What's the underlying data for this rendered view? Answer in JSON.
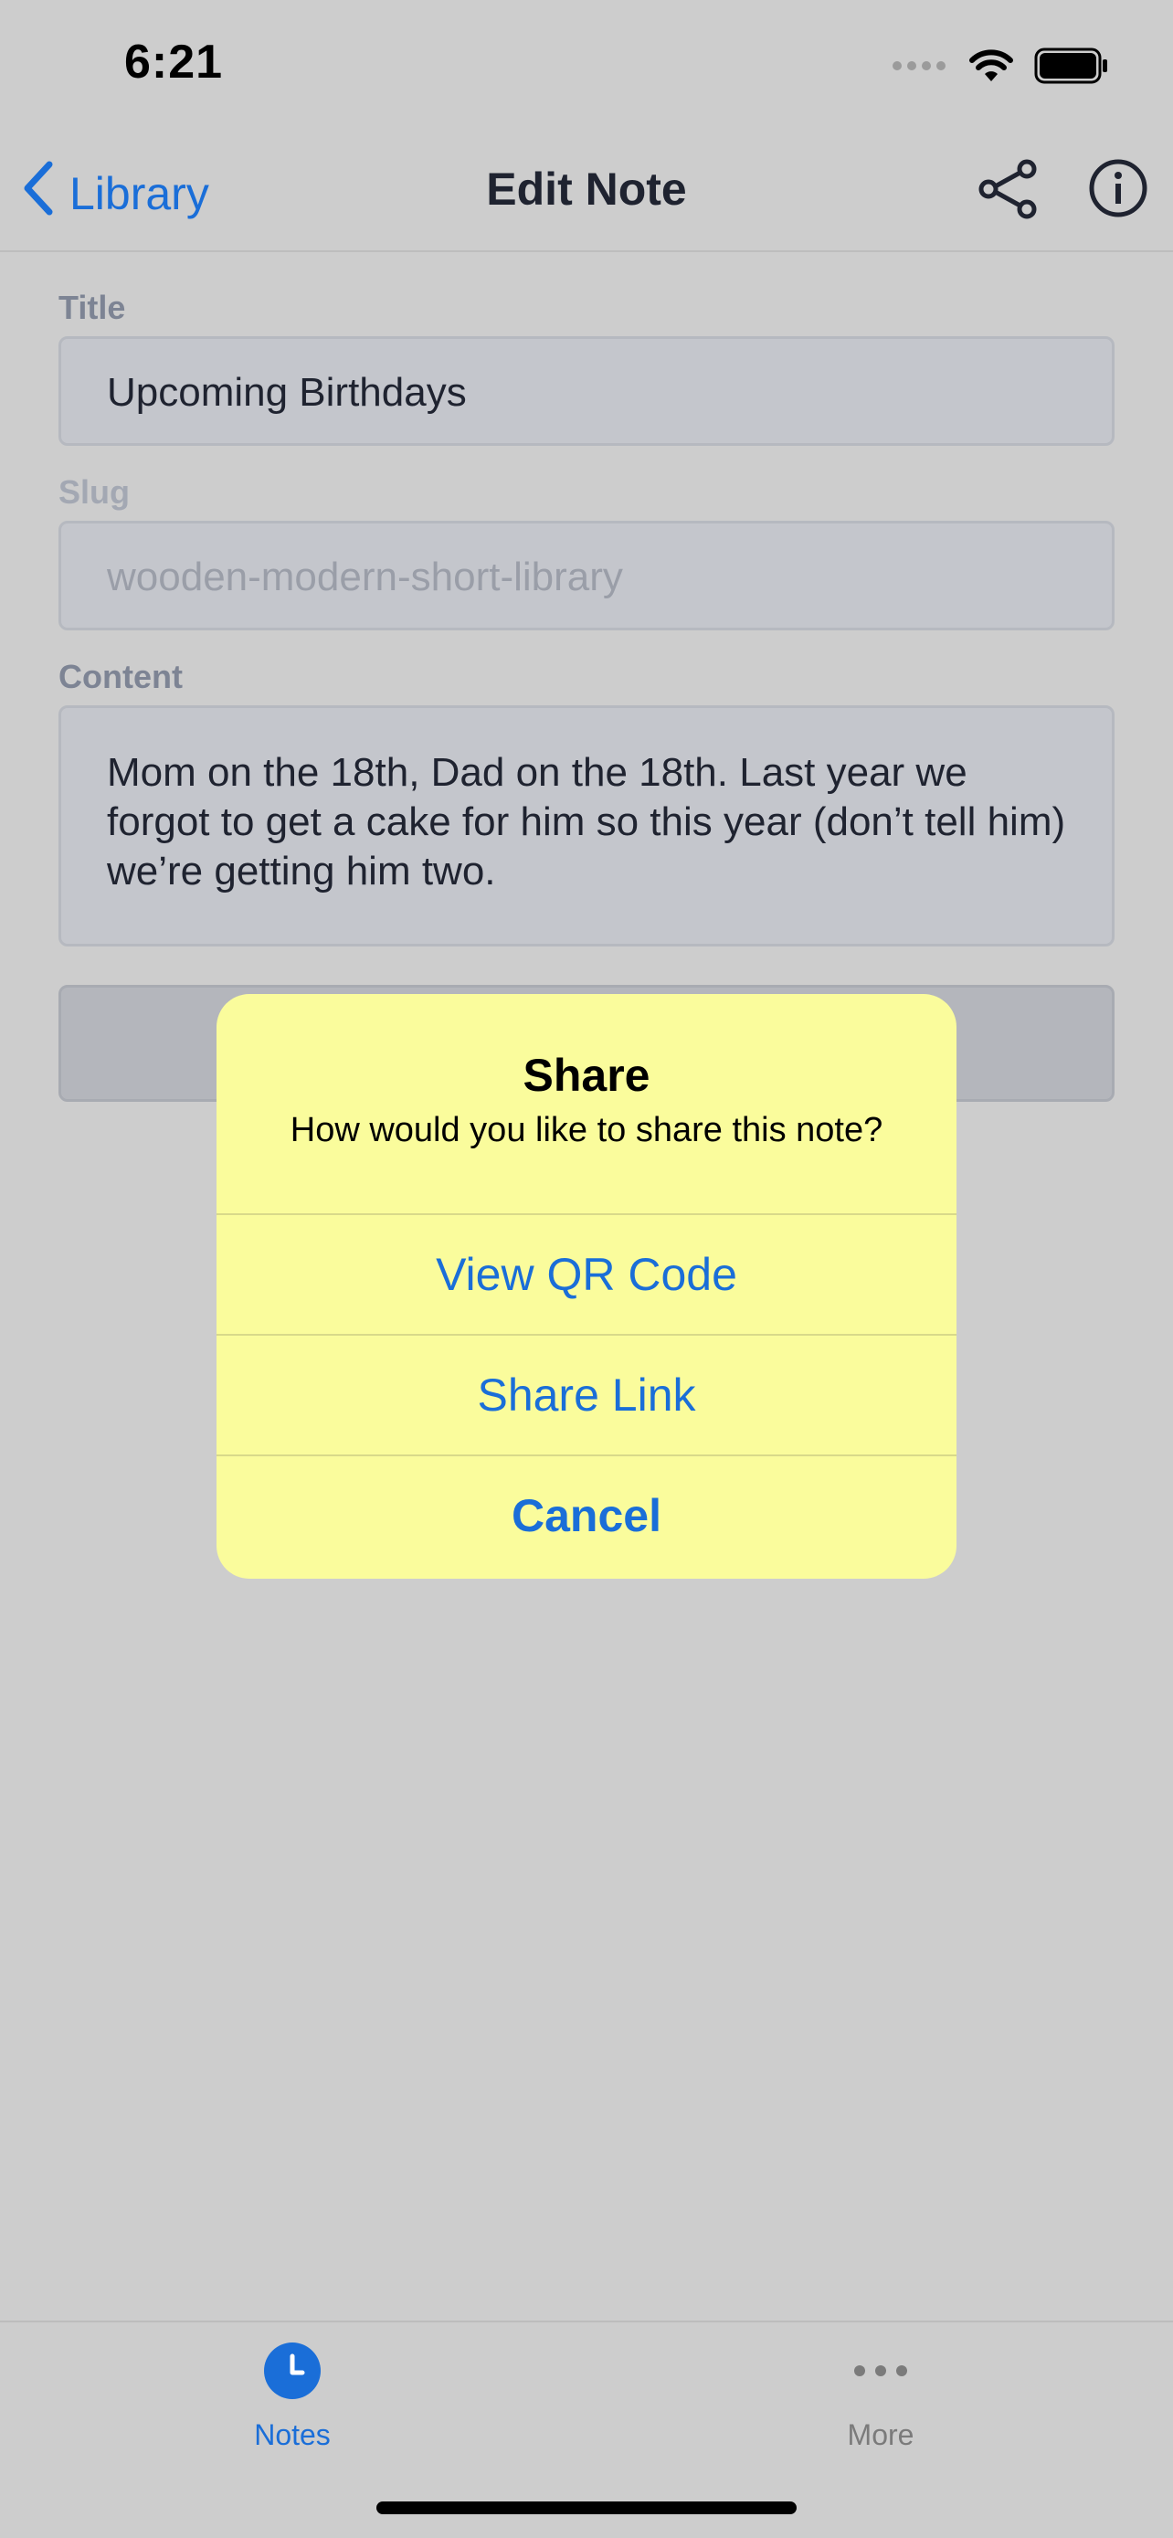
{
  "status_bar": {
    "time": "6:21"
  },
  "navbar": {
    "back_label": "Library",
    "title": "Edit Note"
  },
  "form": {
    "title_label": "Title",
    "title_value": "Upcoming Birthdays",
    "slug_label": "Slug",
    "slug_placeholder": "wooden-modern-short-library",
    "content_label": "Content",
    "content_value": "Mom on the 18th, Dad on the 18th. Last year we forgot to get a cake for him so this year (don’t tell him) we’re getting him two."
  },
  "alert": {
    "title": "Share",
    "message": "How would you like to share this note?",
    "actions": [
      "View QR Code",
      "Share Link",
      "Cancel"
    ]
  },
  "tabbar": {
    "tabs": [
      {
        "label": "Notes",
        "icon": "clock-icon",
        "selected": true
      },
      {
        "label": "More",
        "icon": "ellipsis-icon",
        "selected": false
      }
    ]
  },
  "colors": {
    "accent": "#1a6ed8",
    "alert_background": "#fafc9c",
    "screen_background": "#cdcdcd"
  }
}
